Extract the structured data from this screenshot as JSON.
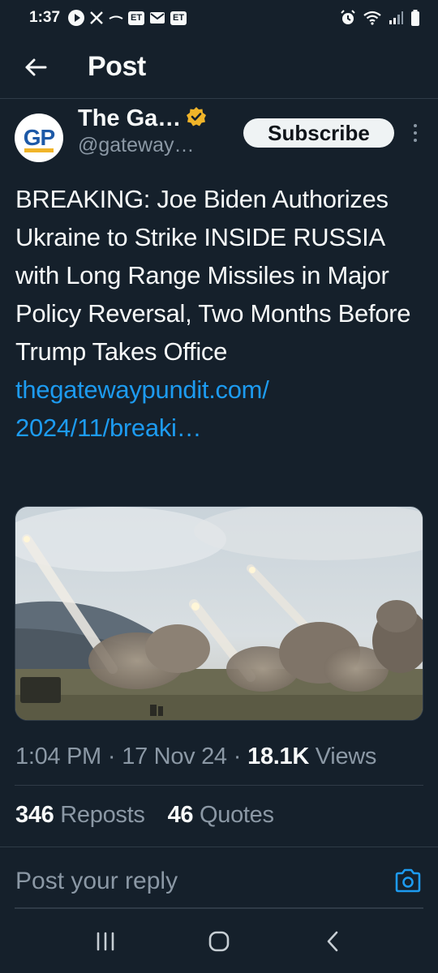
{
  "status_bar": {
    "time": "1:37",
    "left_icons": [
      "play-icon",
      "x-logo-icon",
      "dash-icon",
      "et-icon",
      "mail-icon",
      "et-icon"
    ],
    "et_label": "ET",
    "right_icons": [
      "alarm-icon",
      "wifi-icon",
      "signal-icon",
      "battery-icon"
    ]
  },
  "header": {
    "title": "Post"
  },
  "author": {
    "avatar_text": "GP",
    "display_name": "The Ga…",
    "handle": "@gateway…",
    "verified": true,
    "subscribe_label": "Subscribe"
  },
  "post": {
    "text": "BREAKING: Joe Biden Authorizes Ukraine to Strike INSIDE RUSSIA with Long Range Missiles in Major Policy Reversal, Two Months Before Trump Takes Office",
    "link_line1": "thegatewaypundit.com/",
    "link_line2": "2024/11/breaki…",
    "media_description": "missile-launch-photo"
  },
  "meta": {
    "time": "1:04 PM",
    "sep1": "·",
    "date": "17 Nov 24",
    "sep2": "·",
    "views_count": "18.1K",
    "views_label": "Views"
  },
  "stats": {
    "reposts_count": "346",
    "reposts_label": "Reposts",
    "quotes_count": "46",
    "quotes_label": "Quotes"
  },
  "reply": {
    "placeholder": "Post your reply"
  },
  "colors": {
    "background": "#15202b",
    "text": "#f7f9f9",
    "muted": "#8b98a5",
    "link": "#1d9bf0",
    "verified_badge": "#f0b429",
    "divider": "#2f3b47"
  }
}
